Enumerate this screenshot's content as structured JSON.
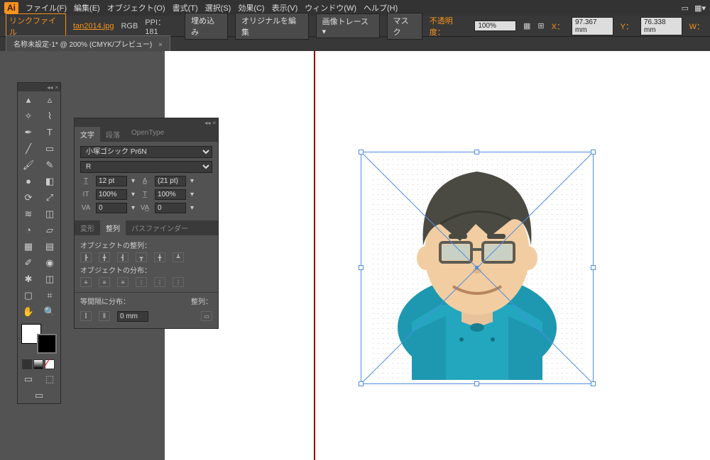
{
  "menu": {
    "app": "Ai",
    "items": [
      "ファイル(F)",
      "編集(E)",
      "オブジェクト(O)",
      "書式(T)",
      "選択(S)",
      "効果(C)",
      "表示(V)",
      "ウィンドウ(W)",
      "ヘルプ(H)"
    ]
  },
  "options": {
    "linklabel": "リンクファイル",
    "filename": "tan2014.jpg",
    "colormode": "RGB",
    "ppi": "PPI：181",
    "embed": "埋め込み",
    "editorig": "オリジナルを編集",
    "trace": "画像トレース",
    "mask": "マスク",
    "opacitylabel": "不透明度：",
    "opacity": "100%",
    "xlabel": "X：",
    "x": "97.367 mm",
    "ylabel": "Y：",
    "y": "76.338 mm",
    "wlabel": "W："
  },
  "tab": {
    "title": "名称未設定-1* @ 200% (CMYK/プレビュー)",
    "close": "×"
  },
  "charpanel": {
    "tabs": [
      "文字",
      "段落",
      "OpenType"
    ],
    "font": "小塚ゴシック Pr6N",
    "style": "R",
    "size": "12 pt",
    "leading": "(21 pt)",
    "hscale": "100%",
    "vscale": "100%",
    "kern": "0",
    "track": "0"
  },
  "alignpanel": {
    "tabs": [
      "変形",
      "整列",
      "パスファインダー"
    ],
    "alignobj": "オブジェクトの整列：",
    "distobj": "オブジェクトの分布：",
    "spacing": "等間隔に分布：",
    "spaceval": "0 mm",
    "aligntolabel": "整列："
  }
}
